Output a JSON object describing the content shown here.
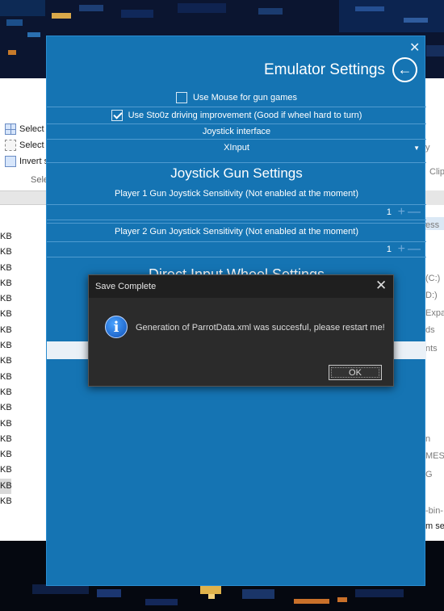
{
  "window": {
    "title": "Emulator Settings",
    "close_glyph": "✕",
    "back_glyph": "←",
    "options": {
      "use_mouse_label": "Use Mouse for gun games",
      "use_mouse_checked": false,
      "driving_label": "Use Sto0z driving improvement (Good if wheel hard to turn)",
      "driving_checked": true
    },
    "joystick_interface_label": "Joystick interface",
    "joystick_interface_value": "XInput",
    "gun_section_title": "Joystick Gun Settings",
    "p1_label": "Player 1 Gun Joystick Sensitivity (Not enabled at the moment)",
    "p1_value": "1",
    "p2_label": "Player 2 Gun Joystick Sensitivity (Not enabled at the moment)",
    "p2_value": "1",
    "wheel_section_title": "Direct Input Wheel Settings"
  },
  "dialog": {
    "title": "Save Complete",
    "message": "Generation of ParrotData.xml was succesful, please restart me!",
    "ok_label": "OK",
    "close_glyph": "✕",
    "icon": "info-icon"
  },
  "explorer_left": {
    "ribbon": [
      "Select a",
      "Select n",
      "Invert s"
    ],
    "group_label": "Sele",
    "size_unit": "KB",
    "rows": 18
  },
  "explorer_right": {
    "labels": [
      "y",
      "Clip",
      "ess",
      "(C:)",
      "D:)",
      "Expa",
      "ds",
      "nts",
      "n",
      "MES",
      "G",
      "-bin-",
      "m se"
    ]
  },
  "colors": {
    "window_bg": "#1574b3",
    "dialog_bg": "#2b2b2b",
    "accent_info": "#1f6fd6"
  }
}
